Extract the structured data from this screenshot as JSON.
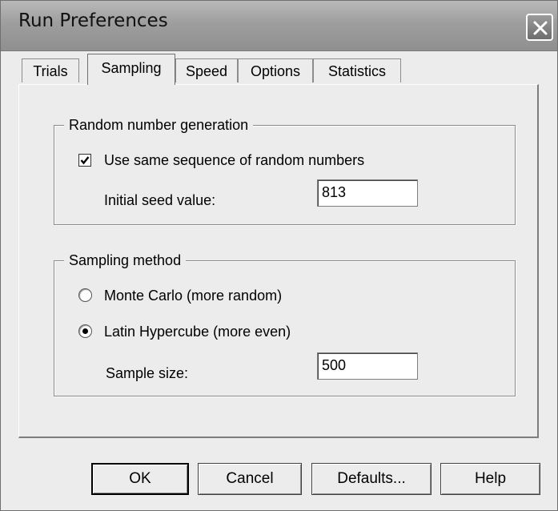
{
  "window": {
    "title": "Run Preferences"
  },
  "tabs": [
    {
      "label": "Trials"
    },
    {
      "label": "Sampling"
    },
    {
      "label": "Speed"
    },
    {
      "label": "Options"
    },
    {
      "label": "Statistics"
    }
  ],
  "active_tab": "Sampling",
  "random_group": {
    "title": "Random number generation",
    "same_sequence_label": "Use same sequence of random numbers",
    "same_sequence_checked": true,
    "seed_label": "Initial seed value:",
    "seed_value": "813"
  },
  "sampling_group": {
    "title": "Sampling method",
    "monte_carlo_label": "Monte Carlo  (more random)",
    "latin_label": "Latin Hypercube  (more even)",
    "selected_method": "Latin Hypercube",
    "sample_size_label": "Sample size:",
    "sample_size_value": "500"
  },
  "buttons": {
    "ok": "OK",
    "cancel": "Cancel",
    "defaults": "Defaults...",
    "help": "Help"
  }
}
